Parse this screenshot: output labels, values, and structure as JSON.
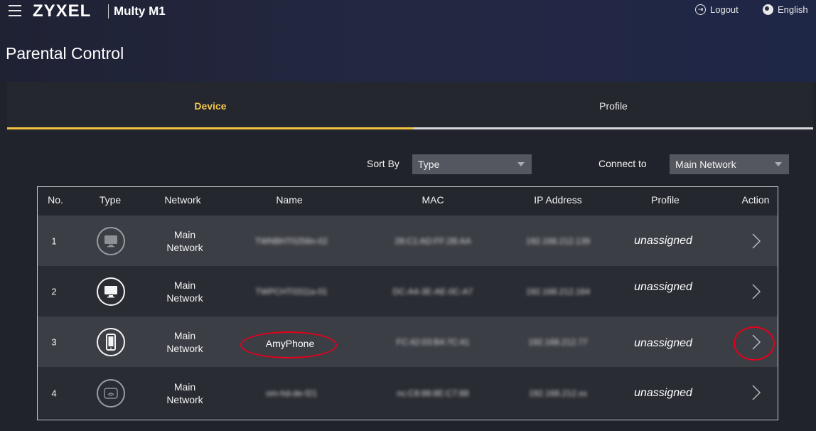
{
  "header": {
    "brand": "ZYXEL",
    "product": "Multy M1",
    "logout_label": "Logout",
    "language_label": "English",
    "page_title": "Parental Control"
  },
  "tabs": [
    {
      "label": "Device",
      "active": true
    },
    {
      "label": "Profile",
      "active": false
    }
  ],
  "filters": {
    "sort_label": "Sort By",
    "sort_value": "Type",
    "connect_label": "Connect to",
    "connect_value": "Main Network"
  },
  "table": {
    "columns": [
      "No.",
      "Type",
      "Network",
      "Name",
      "MAC",
      "IP Address",
      "Profile",
      "Action"
    ],
    "rows": [
      {
        "no": "1",
        "type_icon": "monitor-icon",
        "network_line1": "Main",
        "network_line2": "Network",
        "name": "TWNBHT0256n-02",
        "mac": "28:C1:AD:FF:2B:AA",
        "ip": "192.168.212.139",
        "profile": "unassigned"
      },
      {
        "no": "2",
        "type_icon": "monitor-icon",
        "network_line1": "Main",
        "network_line2": "Network",
        "name": "TWPCHT0311a-01",
        "mac": "DC-A4-3E-AE-0C-A7",
        "ip": "192.168.212.164",
        "profile": "unassigned"
      },
      {
        "no": "3",
        "type_icon": "phone-icon",
        "network_line1": "Main",
        "network_line2": "Network",
        "name": "AmyPhone",
        "mac": "FC:42:03:B4:7C:41",
        "ip": "192.168.212.77",
        "profile": "unassigned"
      },
      {
        "no": "4",
        "type_icon": "router-icon",
        "network_line1": "Main",
        "network_line2": "Network",
        "name": "om-hd-de-f21",
        "mac": "nc:C8:88:8E:C7:88",
        "ip": "192.168.212.xx",
        "profile": "unassigned"
      }
    ]
  },
  "colors": {
    "accent": "#f2c43d",
    "annotation": "#e3001b",
    "row_odd": "#3c3e46",
    "row_even": "#2a2c34"
  }
}
